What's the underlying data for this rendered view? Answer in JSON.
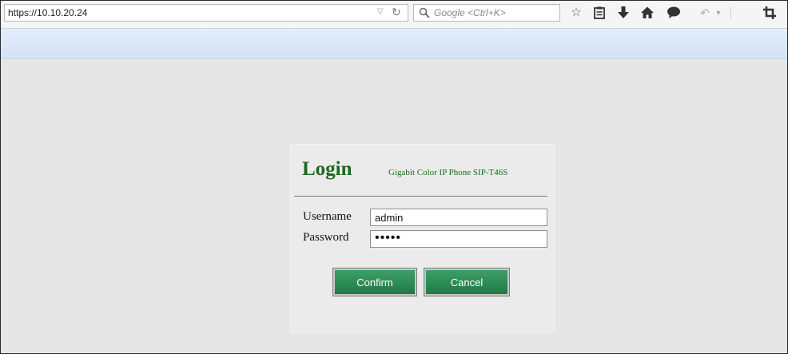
{
  "browser": {
    "url": "https://10.10.20.24",
    "search_placeholder": "Google <Ctrl+K>",
    "icons": [
      "url-dropdown-icon",
      "reload-icon",
      "search-icon",
      "bookmark-star-icon",
      "reading-list-icon",
      "download-icon",
      "home-icon",
      "chat-icon",
      "undo-icon",
      "dropdown-icon",
      "crop-icon"
    ]
  },
  "login": {
    "title": "Login",
    "subtitle": "Gigabit Color IP Phone SIP-T46S",
    "username_label": "Username",
    "username_value": "admin",
    "password_label": "Password",
    "password_value": "admin",
    "confirm_label": "Confirm",
    "cancel_label": "Cancel"
  },
  "colors": {
    "accent_green": "#1c6b1c",
    "button_green": "#2a8a55",
    "page_background": "#e6e6e6"
  }
}
